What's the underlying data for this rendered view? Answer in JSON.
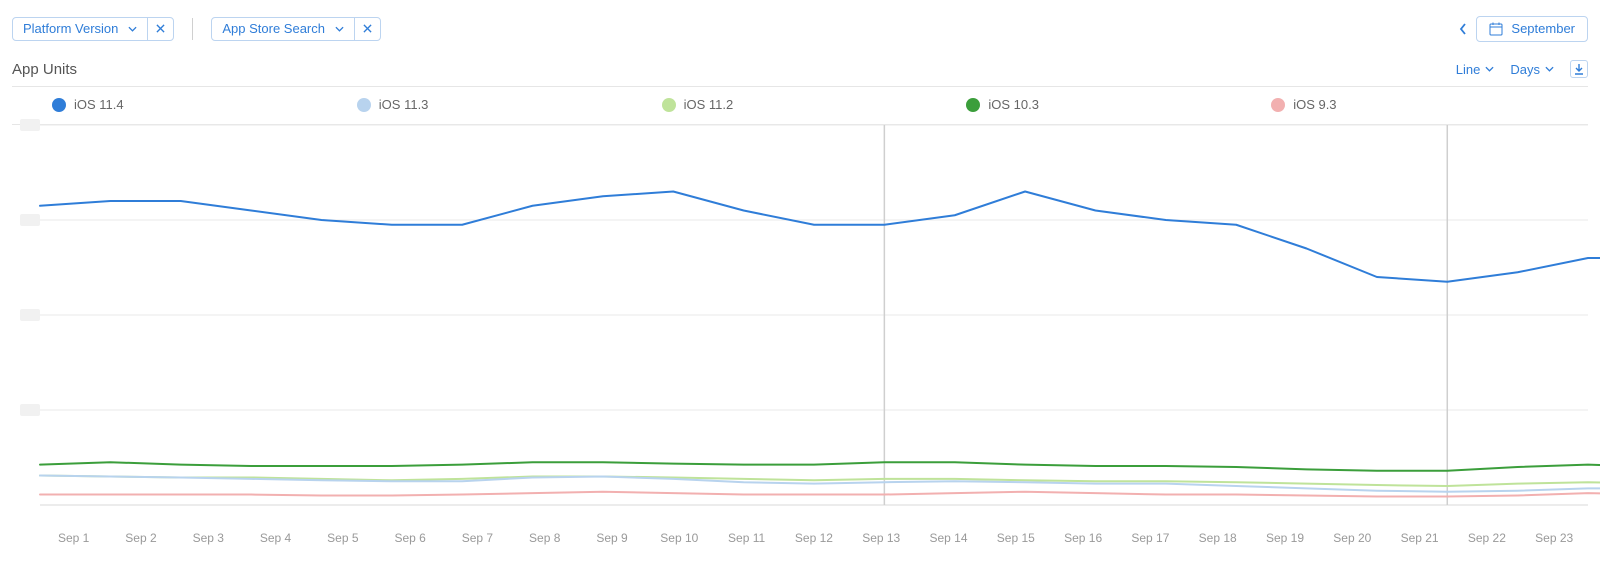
{
  "filters": {
    "platform_version": "Platform Version",
    "app_store_search": "App Store Search"
  },
  "date_picker": {
    "month": "September"
  },
  "title": "App Units",
  "view_toggles": {
    "chart_type": "Line",
    "granularity": "Days"
  },
  "legend": [
    {
      "label": "iOS 11.4",
      "color": "#2f7dd8"
    },
    {
      "label": "iOS 11.3",
      "color": "#b8d3ee"
    },
    {
      "label": "iOS 11.2",
      "color": "#bfe39a"
    },
    {
      "label": "iOS 10.3",
      "color": "#3b9e3b"
    },
    {
      "label": "iOS 9.3",
      "color": "#f2b0b0"
    }
  ],
  "xaxis_labels": [
    "Sep 1",
    "Sep 2",
    "Sep 3",
    "Sep 4",
    "Sep 5",
    "Sep 6",
    "Sep 7",
    "Sep 8",
    "Sep 9",
    "Sep 10",
    "Sep 11",
    "Sep 12",
    "Sep 13",
    "Sep 14",
    "Sep 15",
    "Sep 16",
    "Sep 17",
    "Sep 18",
    "Sep 19",
    "Sep 20",
    "Sep 21",
    "Sep 22",
    "Sep 23"
  ],
  "y_ticks_hidden": [
    8,
    6,
    4,
    2
  ],
  "vert_markers": [
    13,
    21
  ],
  "chart_data": {
    "type": "line",
    "title": "App Units",
    "xlabel": "",
    "ylabel": "",
    "ylim": [
      0,
      8
    ],
    "categories": [
      "Sep 1",
      "Sep 2",
      "Sep 3",
      "Sep 4",
      "Sep 5",
      "Sep 6",
      "Sep 7",
      "Sep 8",
      "Sep 9",
      "Sep 10",
      "Sep 11",
      "Sep 12",
      "Sep 13",
      "Sep 14",
      "Sep 15",
      "Sep 16",
      "Sep 17",
      "Sep 18",
      "Sep 19",
      "Sep 20",
      "Sep 21",
      "Sep 22",
      "Sep 23"
    ],
    "series": [
      {
        "name": "iOS 11.4",
        "color": "#2f7dd8",
        "values": [
          6.3,
          6.4,
          6.4,
          6.2,
          6.0,
          5.9,
          5.9,
          6.3,
          6.5,
          6.6,
          6.2,
          5.9,
          5.9,
          6.1,
          6.6,
          6.2,
          6.0,
          5.9,
          5.4,
          4.8,
          4.7,
          4.9,
          5.2,
          5.2
        ]
      },
      {
        "name": "iOS 10.3",
        "color": "#3b9e3b",
        "values": [
          0.85,
          0.9,
          0.85,
          0.82,
          0.82,
          0.82,
          0.85,
          0.9,
          0.9,
          0.87,
          0.85,
          0.85,
          0.9,
          0.9,
          0.85,
          0.82,
          0.82,
          0.8,
          0.75,
          0.72,
          0.72,
          0.8,
          0.85,
          0.8
        ]
      },
      {
        "name": "iOS 11.2",
        "color": "#bfe39a",
        "values": [
          0.62,
          0.6,
          0.58,
          0.58,
          0.55,
          0.52,
          0.55,
          0.6,
          0.6,
          0.58,
          0.55,
          0.52,
          0.55,
          0.55,
          0.52,
          0.5,
          0.5,
          0.48,
          0.45,
          0.42,
          0.4,
          0.45,
          0.48,
          0.45
        ]
      },
      {
        "name": "iOS 11.3",
        "color": "#b8d3ee",
        "values": [
          0.62,
          0.6,
          0.58,
          0.55,
          0.52,
          0.5,
          0.5,
          0.58,
          0.6,
          0.55,
          0.48,
          0.45,
          0.48,
          0.5,
          0.48,
          0.45,
          0.45,
          0.4,
          0.35,
          0.3,
          0.28,
          0.3,
          0.35,
          0.35
        ]
      },
      {
        "name": "iOS 9.3",
        "color": "#f2b0b0",
        "values": [
          0.22,
          0.22,
          0.22,
          0.22,
          0.2,
          0.2,
          0.22,
          0.25,
          0.28,
          0.25,
          0.22,
          0.22,
          0.22,
          0.25,
          0.28,
          0.25,
          0.22,
          0.22,
          0.2,
          0.18,
          0.18,
          0.2,
          0.25,
          0.22
        ]
      }
    ]
  }
}
